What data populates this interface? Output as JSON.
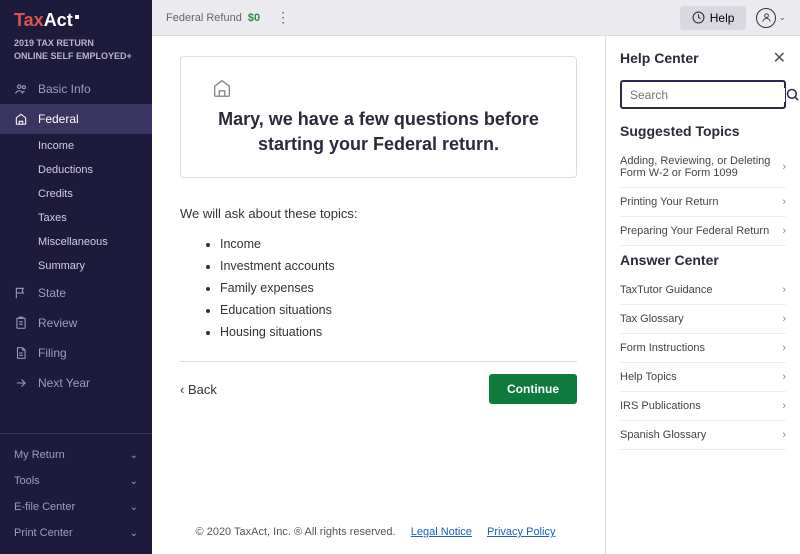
{
  "logo": {
    "part1": "Tax",
    "part2": "Act"
  },
  "plan": {
    "line1": "2019 TAX RETURN",
    "line2": "ONLINE SELF EMPLOYED+"
  },
  "nav": [
    {
      "label": "Basic Info",
      "icon": "user"
    },
    {
      "label": "Federal",
      "icon": "building",
      "active": true,
      "sub": [
        "Income",
        "Deductions",
        "Credits",
        "Taxes",
        "Miscellaneous",
        "Summary"
      ]
    },
    {
      "label": "State",
      "icon": "flag"
    },
    {
      "label": "Review",
      "icon": "clipboard"
    },
    {
      "label": "Filing",
      "icon": "file"
    },
    {
      "label": "Next Year",
      "icon": "arrow"
    }
  ],
  "bottom_nav": [
    "My Return",
    "Tools",
    "E-file Center",
    "Print Center"
  ],
  "topbar": {
    "refund_label": "Federal Refund",
    "refund_amount": "$0",
    "help": "Help"
  },
  "card": {
    "title": "Mary, we have a few questions before starting your Federal return."
  },
  "intro": "We will ask about these topics:",
  "topics": [
    "Income",
    "Investment accounts",
    "Family expenses",
    "Education situations",
    "Housing situations"
  ],
  "actions": {
    "back": "‹  Back",
    "continue": "Continue"
  },
  "footer": {
    "copyright": "© 2020 TaxAct, Inc. ® All rights reserved.",
    "legal": "Legal Notice",
    "privacy": "Privacy Policy"
  },
  "help_panel": {
    "title": "Help Center",
    "search_placeholder": "Search",
    "suggested_title": "Suggested Topics",
    "suggested": [
      "Adding, Reviewing, or Deleting Form W-2 or Form 1099",
      "Printing Your Return",
      "Preparing Your Federal Return"
    ],
    "answer_title": "Answer Center",
    "answer": [
      "TaxTutor Guidance",
      "Tax Glossary",
      "Form Instructions",
      "Help Topics",
      "IRS Publications",
      "Spanish Glossary"
    ]
  }
}
